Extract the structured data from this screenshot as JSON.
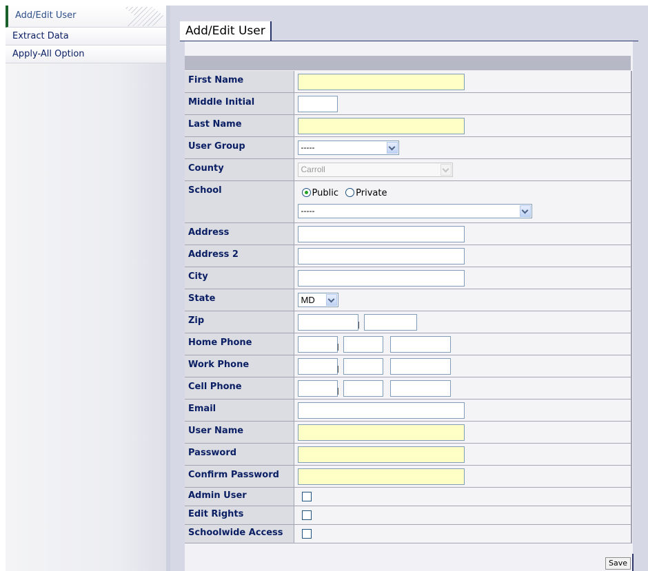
{
  "sidebar": {
    "items": [
      {
        "label": "Add/Edit User",
        "active": true
      },
      {
        "label": "Extract Data",
        "active": false
      },
      {
        "label": "Apply-All Option",
        "active": false
      }
    ]
  },
  "page": {
    "title": "Add/Edit User"
  },
  "form": {
    "first_name": {
      "label": "First Name",
      "value": ""
    },
    "middle_initial": {
      "label": "Middle Initial",
      "value": ""
    },
    "last_name": {
      "label": "Last Name",
      "value": ""
    },
    "user_group": {
      "label": "User Group",
      "selected": "-----"
    },
    "county": {
      "label": "County",
      "selected": "Carroll",
      "disabled": true
    },
    "school": {
      "label": "School",
      "radio_public": "Public",
      "radio_private": "Private",
      "selected_type": "Public",
      "selected": "-----"
    },
    "address": {
      "label": "Address",
      "value": ""
    },
    "address2": {
      "label": "Address 2",
      "value": ""
    },
    "city": {
      "label": "City",
      "value": ""
    },
    "state": {
      "label": "State",
      "selected": "MD"
    },
    "zip": {
      "label": "Zip"
    },
    "home_phone": {
      "label": "Home Phone"
    },
    "work_phone": {
      "label": "Work Phone"
    },
    "cell_phone": {
      "label": "Cell Phone"
    },
    "email": {
      "label": "Email",
      "value": ""
    },
    "user_name": {
      "label": "User Name",
      "value": ""
    },
    "password": {
      "label": "Password",
      "value": ""
    },
    "confirm_password": {
      "label": "Confirm Password",
      "value": ""
    },
    "admin_user": {
      "label": "Admin User",
      "checked": false
    },
    "edit_rights": {
      "label": "Edit Rights",
      "checked": false
    },
    "schoolwide_access": {
      "label": "Schoolwide Access",
      "checked": false
    }
  },
  "actions": {
    "save_label": "Save"
  },
  "colors": {
    "required_field": "#ffffc6",
    "label_text": "#0a1e63",
    "active_marker": "#1b5f2a"
  }
}
